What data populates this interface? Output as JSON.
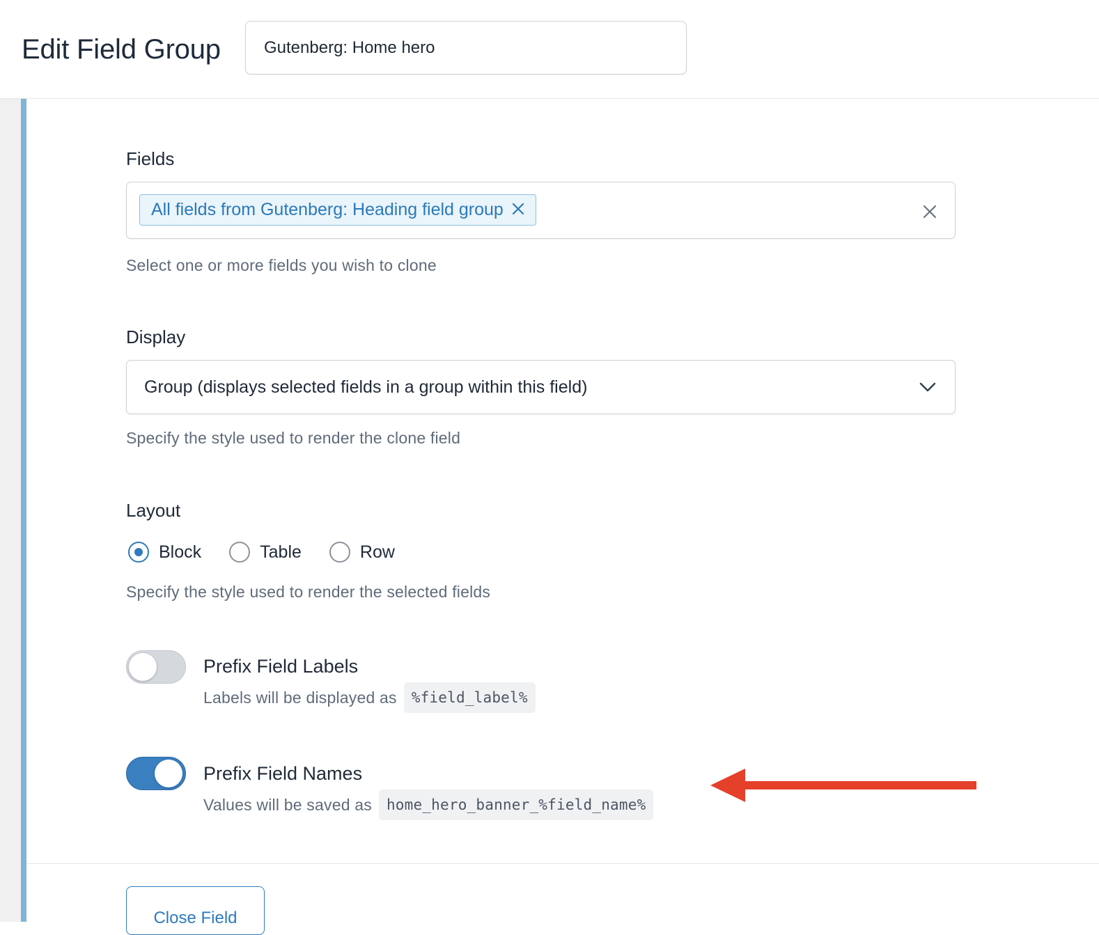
{
  "header": {
    "title": "Edit Field Group",
    "group_name": "Gutenberg: Home hero"
  },
  "fields": {
    "label": "Fields",
    "selected": [
      {
        "label": "All fields from Gutenberg: Heading field group",
        "remove_icon": "close-icon"
      }
    ],
    "clear_icon": "close-icon",
    "help": "Select one or more fields you wish to clone"
  },
  "display": {
    "label": "Display",
    "value": "Group (displays selected fields in a group within this field)",
    "dropdown_icon": "chevron-down-icon",
    "help": "Specify the style used to render the clone field"
  },
  "layout": {
    "label": "Layout",
    "options": [
      {
        "label": "Block",
        "checked": true
      },
      {
        "label": "Table",
        "checked": false
      },
      {
        "label": "Row",
        "checked": false
      }
    ],
    "help": "Specify the style used to render the selected fields"
  },
  "prefix_labels": {
    "title": "Prefix Field Labels",
    "enabled": false,
    "desc": "Labels will be displayed as",
    "code": "%field_label%"
  },
  "prefix_names": {
    "title": "Prefix Field Names",
    "enabled": true,
    "desc": "Values will be saved as",
    "code": "home_hero_banner_%field_name%"
  },
  "footer": {
    "close_button": "Close Field"
  },
  "colors": {
    "accent": "#2f7bbd",
    "left_bar": "#7fb4d9",
    "annotation_arrow": "#e5402a"
  }
}
